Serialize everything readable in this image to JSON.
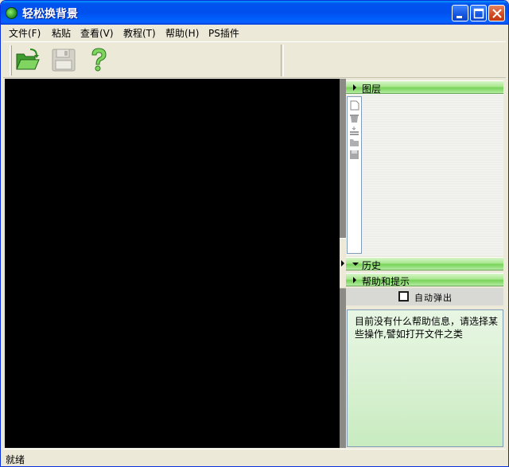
{
  "window": {
    "title": "轻松换背景"
  },
  "menu": {
    "items": [
      {
        "label": "文件(F)"
      },
      {
        "label": "粘贴"
      },
      {
        "label": "查看(V)"
      },
      {
        "label": "教程(T)"
      },
      {
        "label": "帮助(H)"
      },
      {
        "label": "PS插件"
      }
    ]
  },
  "toolbar": {
    "buttons": [
      {
        "icon": "open-folder-icon",
        "state": "enabled"
      },
      {
        "icon": "save-disk-icon",
        "state": "disabled"
      },
      {
        "icon": "help-question-icon",
        "state": "enabled"
      }
    ]
  },
  "panels": {
    "layers": {
      "title": "图层",
      "expanded": true
    },
    "history": {
      "title": "历史",
      "expanded": false
    },
    "help": {
      "title": "帮助和提示",
      "auto_popup_label": "自动弹出",
      "auto_popup_checked": false,
      "message": "目前没有什么帮助信息，请选择某些操作,譬如打开文件之类"
    }
  },
  "status": {
    "text": "就绪"
  },
  "colors": {
    "titlebar": "#0053ee",
    "panel_header": "#79d35a",
    "canvas": "#000000",
    "help_bg": "#d6f0cf"
  }
}
